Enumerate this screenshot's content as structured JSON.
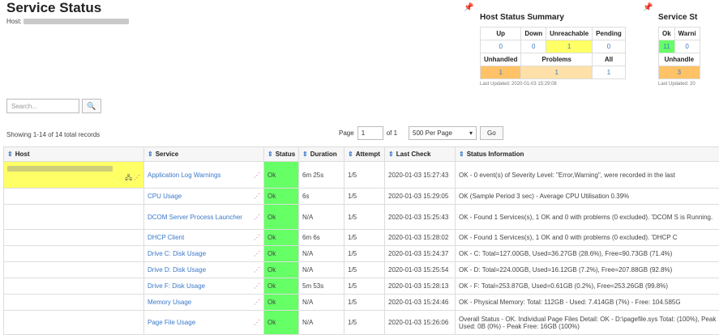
{
  "page": {
    "title": "Service Status",
    "host_label": "Host:"
  },
  "host_summary": {
    "title": "Host Status Summary",
    "headers1": [
      "Up",
      "Down",
      "Unreachable",
      "Pending"
    ],
    "values1": [
      "0",
      "0",
      "1",
      "0"
    ],
    "headers2": [
      "Unhandled",
      "Problems",
      "All"
    ],
    "values2": [
      "1",
      "1",
      "1"
    ],
    "updated": "Last Updated: 2020-01-03 15:29:08"
  },
  "service_summary": {
    "title": "Service St",
    "headers1": [
      "Ok",
      "Warni"
    ],
    "values1": [
      "11",
      "0"
    ],
    "headers2": [
      "Unhandle"
    ],
    "values2": [
      "3"
    ],
    "updated": "Last Updated: 20"
  },
  "search": {
    "placeholder": "Search...",
    "button_icon": "search-icon"
  },
  "records_text": "Showing 1-14 of 14 total records",
  "pager": {
    "page_label": "Page",
    "page_value": "1",
    "of_label": "of 1",
    "per_page": "500 Per Page",
    "go": "Go"
  },
  "columns": [
    "Host",
    "Service",
    "Status",
    "Duration",
    "Attempt",
    "Last Check",
    "Status Information"
  ],
  "rows": [
    {
      "service": "Application Log Warnings",
      "status": "Ok",
      "duration": "6m 25s",
      "attempt": "1/5",
      "last_check": "2020-01-03 15:27:43",
      "info": "OK - 0 event(s) of Severity Level: \"Error,Warning\", were recorded in the last"
    },
    {
      "service": "CPU Usage",
      "status": "Ok",
      "duration": "6s",
      "attempt": "1/5",
      "last_check": "2020-01-03 15:29:05",
      "info": "OK (Sample Period 3 sec) - Average CPU Utilisation 0.39%"
    },
    {
      "service": "DCOM Server Process Launcher",
      "status": "Ok",
      "duration": "N/A",
      "attempt": "1/5",
      "last_check": "2020-01-03 15:25:43",
      "info": "OK - Found 1 Services(s), 1 OK and 0 with problems (0 excluded). 'DCOM S is Running."
    },
    {
      "service": "DHCP Client",
      "status": "Ok",
      "duration": "6m 6s",
      "attempt": "1/5",
      "last_check": "2020-01-03 15:28:02",
      "info": "OK - Found 1 Services(s), 1 OK and 0 with problems (0 excluded). 'DHCP C"
    },
    {
      "service": "Drive C: Disk Usage",
      "status": "Ok",
      "duration": "N/A",
      "attempt": "1/5",
      "last_check": "2020-01-03 15:24:37",
      "info": "OK - C: Total=127.00GB, Used=36.27GB (28.6%), Free=90.73GB (71.4%)"
    },
    {
      "service": "Drive D: Disk Usage",
      "status": "Ok",
      "duration": "N/A",
      "attempt": "1/5",
      "last_check": "2020-01-03 15:25:54",
      "info": "OK - D: Total=224.00GB, Used=16.12GB (7.2%), Free=207.88GB (92.8%)"
    },
    {
      "service": "Drive F: Disk Usage",
      "status": "Ok",
      "duration": "5m 53s",
      "attempt": "1/5",
      "last_check": "2020-01-03 15:28:13",
      "info": "OK - F: Total=253.87GB, Used=0.61GB (0.2%), Free=253.26GB (99.8%)"
    },
    {
      "service": "Memory Usage",
      "status": "Ok",
      "duration": "N/A",
      "attempt": "1/5",
      "last_check": "2020-01-03 15:24:46",
      "info": "OK - Physical Memory: Total: 112GB - Used: 7.414GB (7%) - Free: 104.585G"
    },
    {
      "service": "Page File Usage",
      "status": "Ok",
      "duration": "N/A",
      "attempt": "1/5",
      "last_check": "2020-01-03 15:26:06",
      "info": "Overall Status - OK. Individual Page Files Detail: OK - D:\\pagefile.sys Total: (100%), Peak Used: 0B (0%) - Peak Free: 16GB (100%)"
    }
  ]
}
